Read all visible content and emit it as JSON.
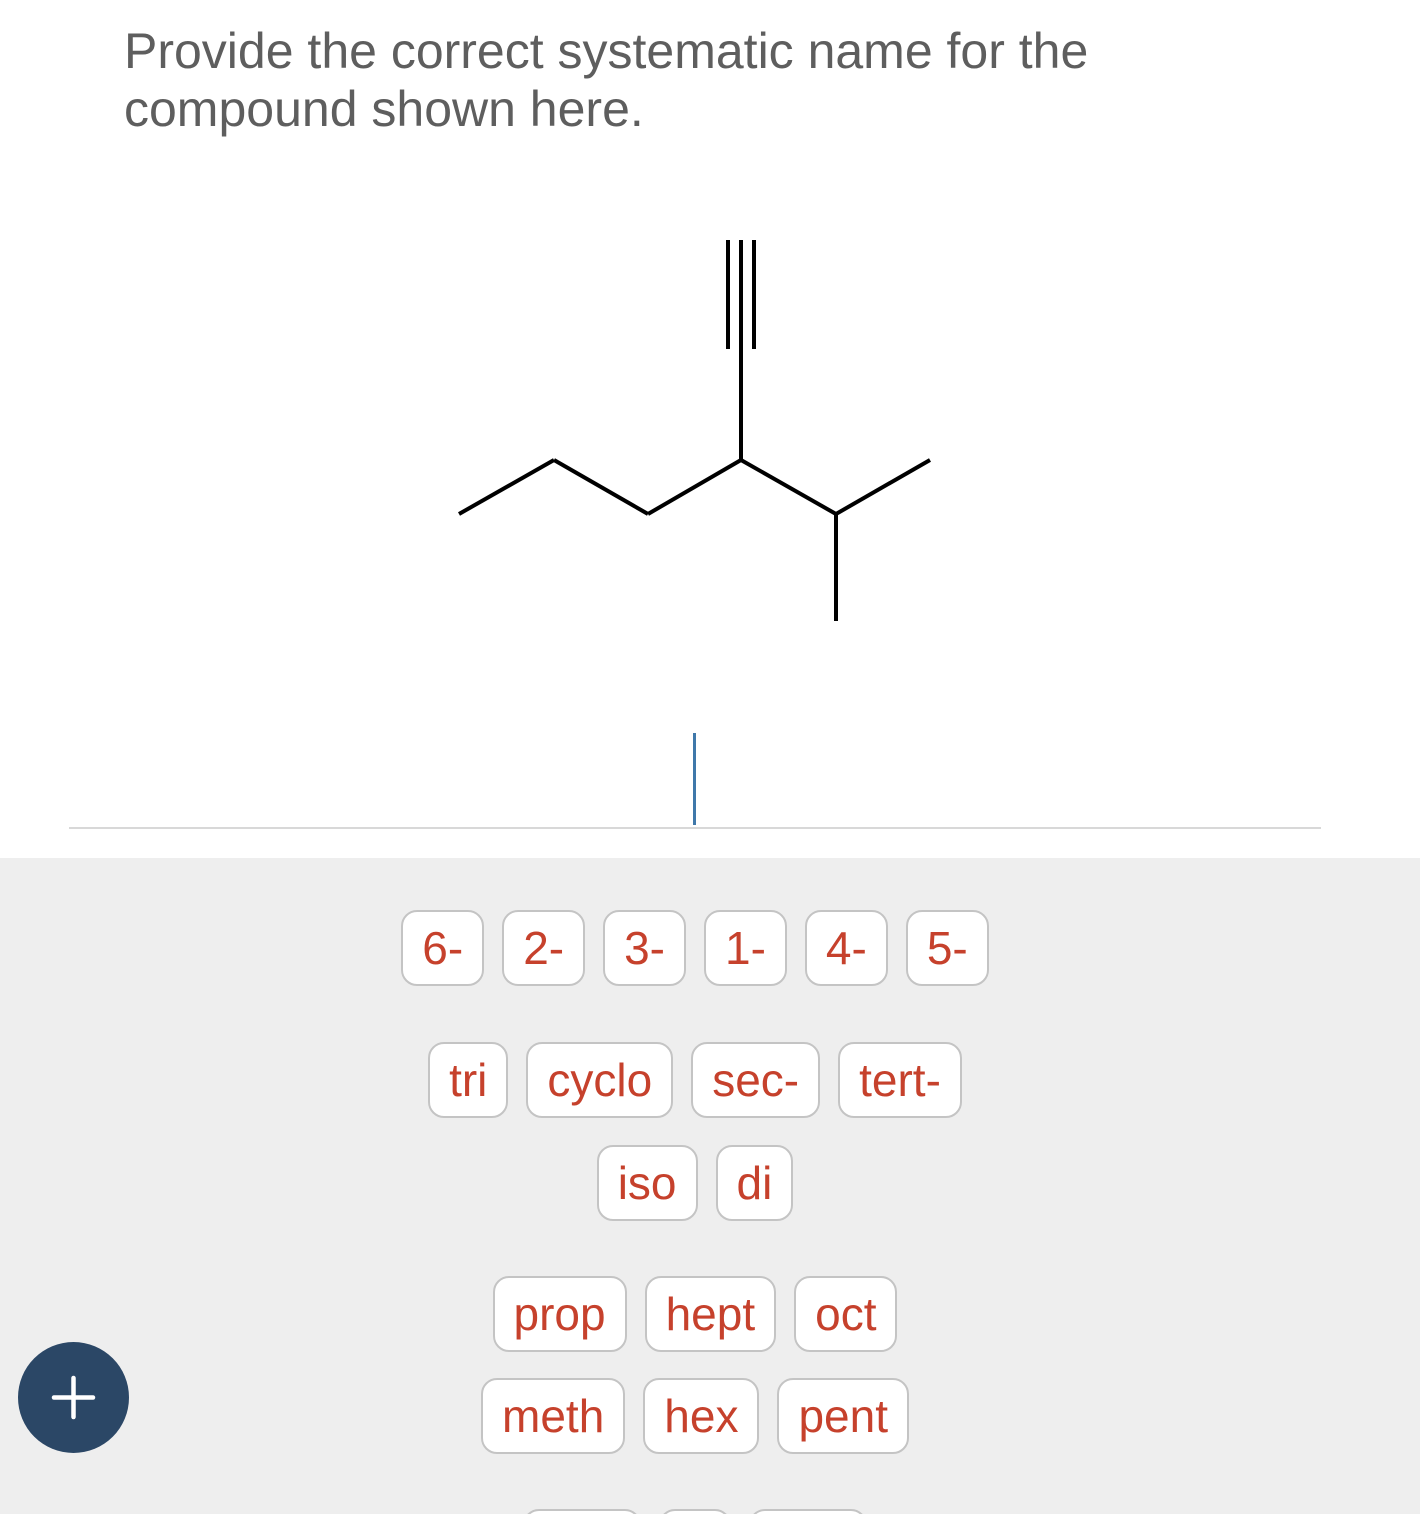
{
  "question": {
    "text": "Provide the correct systematic name for the compound shown here."
  },
  "answer": {
    "value": ""
  },
  "palette": {
    "locants": [
      "6-",
      "2-",
      "3-",
      "1-",
      "4-",
      "5-"
    ],
    "prefixes_row1": [
      "tri",
      "cyclo",
      "sec-",
      "tert-"
    ],
    "prefixes_row2": [
      "iso",
      "di"
    ],
    "roots_row1": [
      "prop",
      "hept",
      "oct"
    ],
    "roots_row2": [
      "meth",
      "hex",
      "pent"
    ],
    "roots_row3": [
      "",
      "",
      ""
    ]
  },
  "add_button": {
    "icon": "plus-icon"
  },
  "colors": {
    "tile_text": "#c6412c",
    "tile_border": "#c4c4c4",
    "palette_bg": "#eeeeee",
    "cursor": "#3f78aa",
    "add_button_bg": "#2b4766",
    "question_text": "#5e5e5e"
  }
}
